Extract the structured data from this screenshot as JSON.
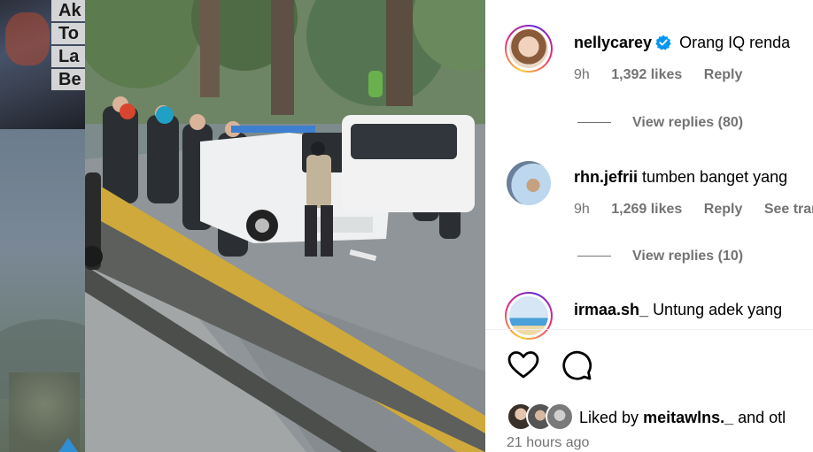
{
  "backdrop": {
    "text_fragments": [
      "Ak",
      "To",
      "La",
      "Be"
    ]
  },
  "media": {
    "kind": "photo"
  },
  "comments": [
    {
      "username": "nellycarey",
      "verified": true,
      "text": "Orang IQ renda",
      "time": "9h",
      "likes": "1,392 likes",
      "reply": "Reply",
      "translate": "",
      "view_replies": "View replies (80)",
      "avatar_ring": true
    },
    {
      "username": "rhn.jefrii",
      "verified": false,
      "text": "tumben banget yang",
      "time": "9h",
      "likes": "1,269 likes",
      "reply": "Reply",
      "translate": "See trans",
      "view_replies": "View replies (10)",
      "avatar_ring": false
    },
    {
      "username": "irmaa.sh_",
      "verified": false,
      "text": "Untung adek yang",
      "avatar_ring": true
    }
  ],
  "actions": {
    "like_icon": "heart-icon",
    "comment_icon": "comment-icon"
  },
  "likes_summary": {
    "prefix": "Liked by",
    "user": "meitawlns._",
    "suffix": "and otl"
  },
  "post_time": "21 hours ago",
  "colors": {
    "verified": "#0095f6",
    "meta_gray": "#737373",
    "ring_start": "#f9ce34",
    "ring_mid": "#ee2a7b",
    "ring_end": "#6228d7"
  }
}
